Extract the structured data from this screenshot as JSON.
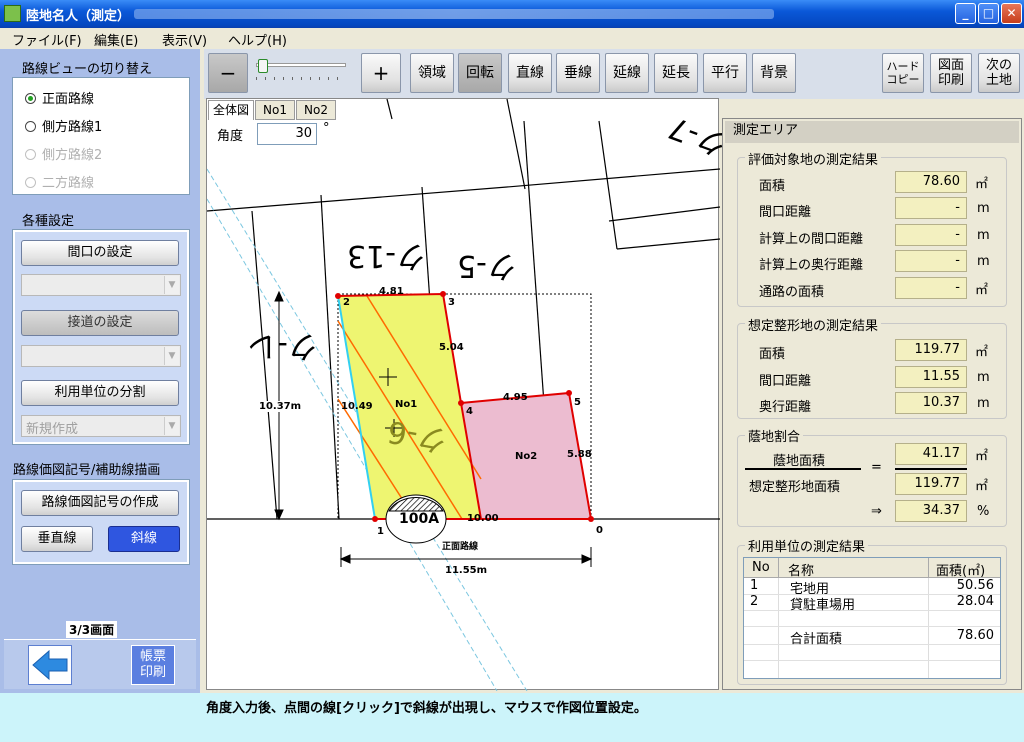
{
  "window": {
    "title": "陸地名人（測定）",
    "min": "_",
    "max": "□",
    "close": "✕"
  },
  "menu": [
    "ファイル(F)",
    "編集(E)",
    "表示(V)",
    "ヘルプ(H)"
  ],
  "left": {
    "route_view_title": "路線ビューの切り替え",
    "routes": [
      {
        "label": "正面路線",
        "state": "selected"
      },
      {
        "label": "側方路線1",
        "state": "enabled"
      },
      {
        "label": "側方路線2",
        "state": "disabled"
      },
      {
        "label": "二方路線",
        "state": "disabled"
      }
    ],
    "settings_title": "各種設定",
    "frontage_btn": "間口の設定",
    "road_btn": "接道の設定",
    "split_btn": "利用単位の分割",
    "new_create": "新規作成",
    "symbol_title": "路線価図記号/補助線描画",
    "symbol_btn": "路線価図記号の作成",
    "vertical_btn": "垂直線",
    "diagonal_btn": "斜線",
    "page_indicator": "3/3画面",
    "print_btn": "帳票\n印刷"
  },
  "toolbar": {
    "minus": "−",
    "plus": "+",
    "buttons": [
      "領域",
      "回転",
      "直線",
      "垂線",
      "延線",
      "延長",
      "平行",
      "背景"
    ],
    "hardcopy": "ハード\nコピー",
    "print_map": "図面\n印刷",
    "next_land": "次の\n土地"
  },
  "tabs": [
    "全体図",
    "No1",
    "No2"
  ],
  "drawing": {
    "angle_label": "角度",
    "angle_value": "30",
    "angle_unit": "°",
    "parcels": [
      "ク-13",
      "ク-5",
      "ク-6",
      "ク-レ",
      "ク-7"
    ],
    "lot1": "No1",
    "lot2": "No2",
    "points": [
      "1",
      "2",
      "3",
      "4",
      "5",
      "0"
    ],
    "lengths": {
      "top": "4.81",
      "right1": "5.04",
      "left": "10.49",
      "mid": "4.95",
      "right2": "5.88",
      "bottom": "10.00"
    },
    "dims": {
      "height": "10.37m",
      "width": "11.55m"
    },
    "road_price": "100A",
    "road_label": "正面路線"
  },
  "measure": {
    "title": "測定エリア",
    "eval_title": "評価対象地の測定結果",
    "eval_rows": [
      {
        "label": "面積",
        "value": "78.60",
        "unit": "㎡"
      },
      {
        "label": "間口距離",
        "value": "-",
        "unit": "m"
      },
      {
        "label": "計算上の間口距離",
        "value": "-",
        "unit": "m"
      },
      {
        "label": "計算上の奥行距離",
        "value": "-",
        "unit": "m"
      },
      {
        "label": "通路の面積",
        "value": "-",
        "unit": "㎡"
      }
    ],
    "shape_title": "想定整形地の測定結果",
    "shape_rows": [
      {
        "label": "面積",
        "value": "119.77",
        "unit": "㎡"
      },
      {
        "label": "間口距離",
        "value": "11.55",
        "unit": "m"
      },
      {
        "label": "奥行距離",
        "value": "10.37",
        "unit": "m"
      }
    ],
    "ratio_title": "蔭地割合",
    "ratio_num_label": "蔭地面積",
    "ratio_num_value": "41.17",
    "ratio_den_label": "想定整形地面積",
    "ratio_den_value": "119.77",
    "ratio_eq": "=",
    "ratio_arrow": "⇒",
    "ratio_value": "34.37",
    "ratio_unit": "%",
    "unit_m2": "㎡",
    "units_title": "利用単位の測定結果",
    "units_headers": [
      "No",
      "名称",
      "面積(㎡)"
    ],
    "units_rows": [
      {
        "no": "1",
        "name": "宅地用",
        "area": "50.56"
      },
      {
        "no": "2",
        "name": "貸駐車場用",
        "area": "28.04"
      }
    ],
    "total_label": "合計面積",
    "total_value": "78.60"
  },
  "status": "角度入力後、点間の線[クリック]で斜線が出現し、マウスで作図位置設定。"
}
